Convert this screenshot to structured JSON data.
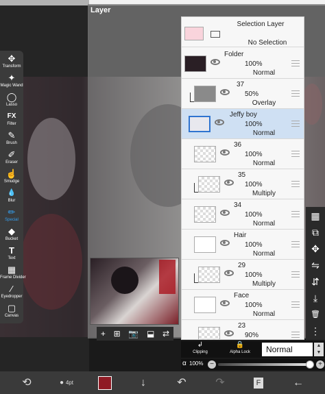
{
  "panel": {
    "title": "Layer"
  },
  "tools": [
    {
      "label": "Transform",
      "icon": "move-icon",
      "glyph": "✥"
    },
    {
      "label": "Magic Wand",
      "icon": "magic-wand-icon",
      "glyph": "✦"
    },
    {
      "label": "Lasso",
      "icon": "lasso-icon",
      "glyph": "◯"
    },
    {
      "label": "Filter",
      "icon": "fx-icon",
      "glyph": "FX"
    },
    {
      "label": "Brush",
      "icon": "brush-icon",
      "glyph": "✎"
    },
    {
      "label": "Eraser",
      "icon": "eraser-icon",
      "glyph": "✐"
    },
    {
      "label": "Smudge",
      "icon": "smudge-icon",
      "glyph": "☝"
    },
    {
      "label": "Blur",
      "icon": "blur-icon",
      "glyph": "💧"
    },
    {
      "label": "Special",
      "icon": "special-pen-icon",
      "glyph": "✏"
    },
    {
      "label": "Bucket",
      "icon": "bucket-icon",
      "glyph": "◆"
    },
    {
      "label": "Text",
      "icon": "text-icon",
      "glyph": "T"
    },
    {
      "label": "Frame Divider",
      "icon": "frame-divider-icon",
      "glyph": "▦"
    },
    {
      "label": "Eyedropper",
      "icon": "eyedropper-icon",
      "glyph": "⁄"
    },
    {
      "label": "Canvas",
      "icon": "canvas-icon",
      "glyph": "▢"
    }
  ],
  "preview_actions": [
    "+",
    "⊞",
    "📷",
    "⬓",
    "⇄"
  ],
  "selection_layer": {
    "name": "Selection Layer",
    "status": "No Selection"
  },
  "layers": [
    {
      "name": "Folder",
      "opacity": "100%",
      "blend": "Normal",
      "clipped": false,
      "selected": false,
      "folder": true
    },
    {
      "name": "37",
      "opacity": "50%",
      "blend": "Overlay",
      "clipped": true,
      "selected": false,
      "folder": false
    },
    {
      "name": "Jeffy boy",
      "opacity": "100%",
      "blend": "Normal",
      "clipped": false,
      "selected": true,
      "folder": false
    },
    {
      "name": "36",
      "opacity": "100%",
      "blend": "Normal",
      "clipped": false,
      "selected": false,
      "folder": false
    },
    {
      "name": "35",
      "opacity": "100%",
      "blend": "Multiply",
      "clipped": true,
      "selected": false,
      "folder": false
    },
    {
      "name": "34",
      "opacity": "100%",
      "blend": "Normal",
      "clipped": false,
      "selected": false,
      "folder": false
    },
    {
      "name": "Hair",
      "opacity": "100%",
      "blend": "Normal",
      "clipped": false,
      "selected": false,
      "folder": true
    },
    {
      "name": "29",
      "opacity": "100%",
      "blend": "Multiply",
      "clipped": true,
      "selected": false,
      "folder": false
    },
    {
      "name": "Face",
      "opacity": "100%",
      "blend": "Normal",
      "clipped": false,
      "selected": false,
      "folder": true
    },
    {
      "name": "23",
      "opacity": "90%",
      "blend": "",
      "clipped": false,
      "selected": false,
      "folder": false
    }
  ],
  "right_tools": [
    {
      "icon": "checker-icon",
      "glyph": "▦"
    },
    {
      "icon": "add-layer-icon",
      "glyph": "⧉"
    },
    {
      "icon": "move-layer-icon",
      "glyph": "✥"
    },
    {
      "icon": "flip-horizontal-icon",
      "glyph": "⇋"
    },
    {
      "icon": "flip-vertical-icon",
      "glyph": "⇵"
    },
    {
      "icon": "merge-down-icon",
      "glyph": "⤓"
    },
    {
      "icon": "trash-icon",
      "glyph": "🗑"
    },
    {
      "icon": "more-icon",
      "glyph": "⋮"
    }
  ],
  "layer_controls": {
    "clipping_label": "Clipping",
    "alpha_lock_label": "Alpha Lock",
    "blend_mode": "Normal"
  },
  "opacity": {
    "symbol": "α",
    "value": "100%",
    "fraction": 1.0
  },
  "bottom_bar": {
    "brush_size": "4pt",
    "color": "#8f1b25",
    "page_label": "F"
  }
}
